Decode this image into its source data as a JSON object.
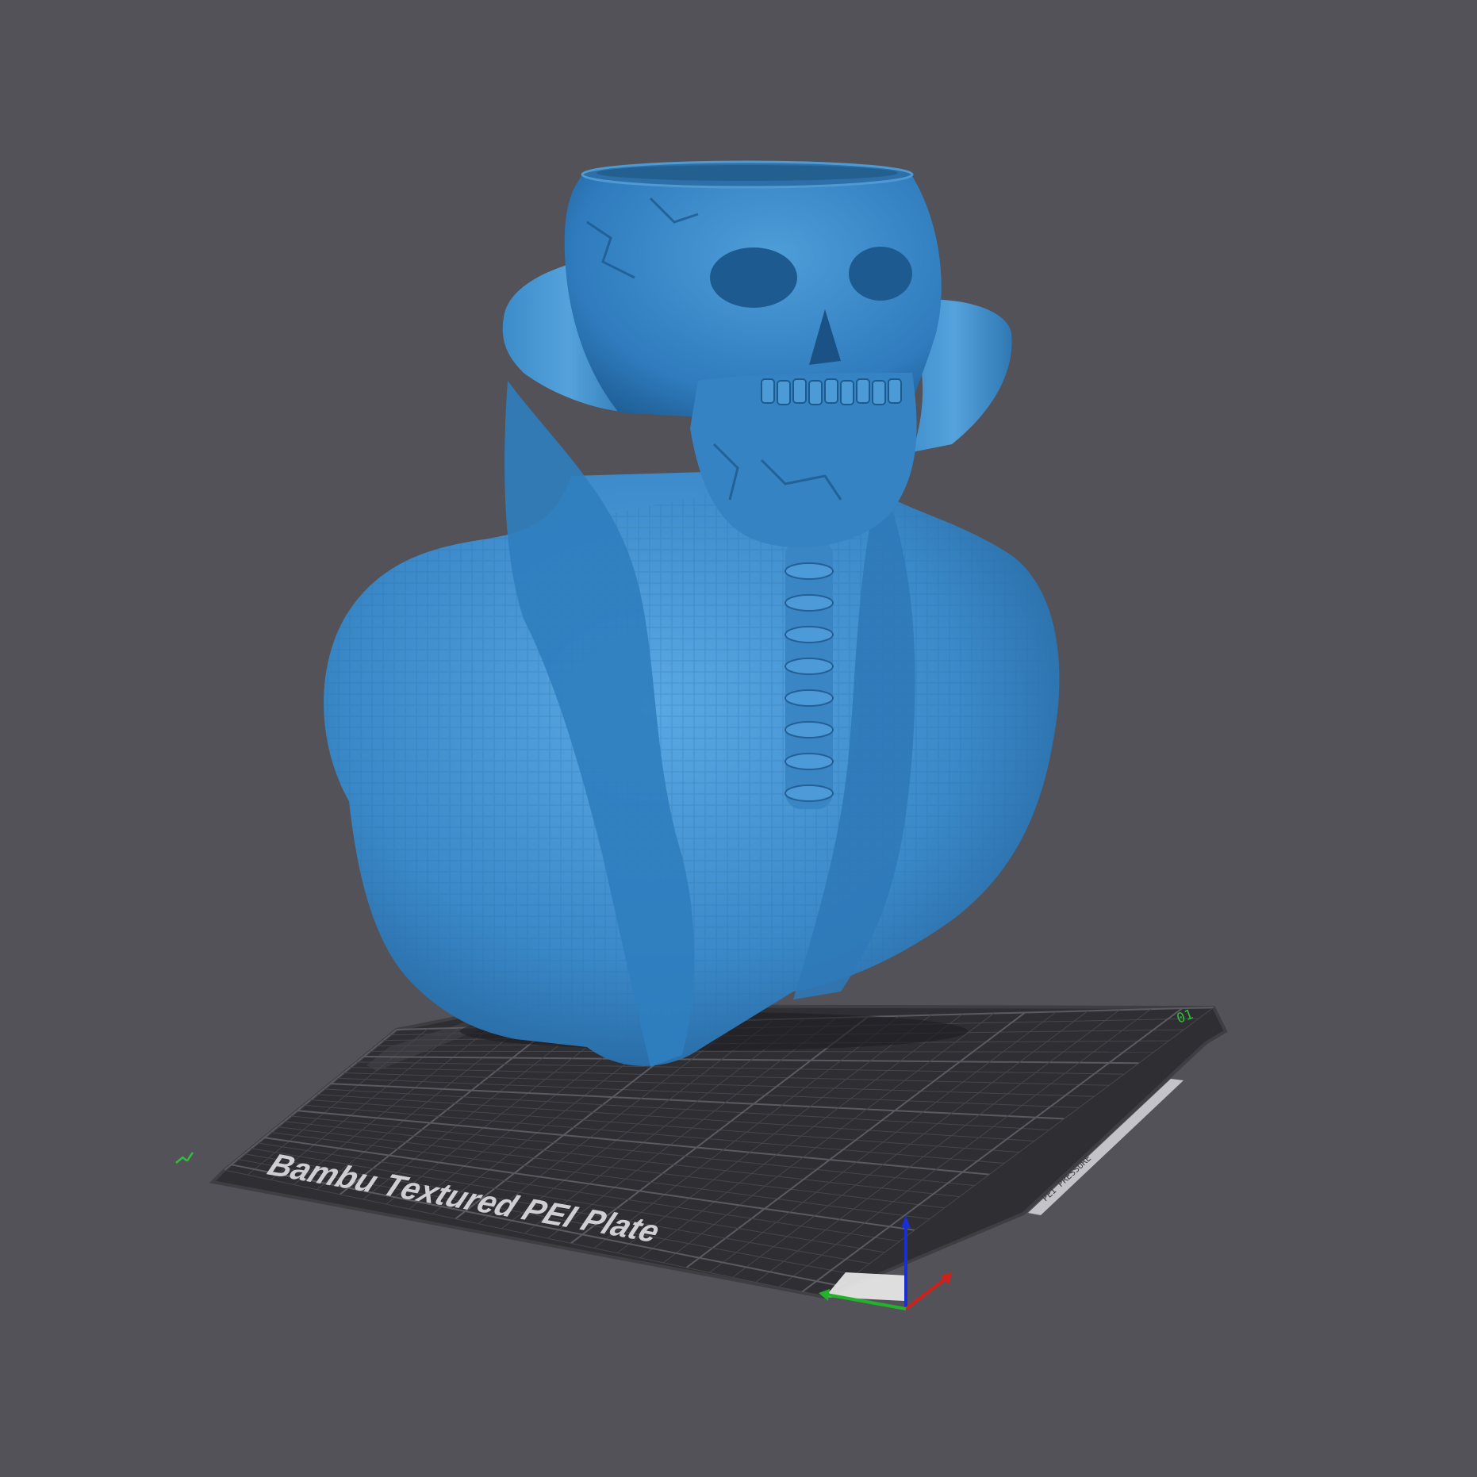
{
  "plate": {
    "label": "Bambu Textured PEI Plate",
    "plate_number": "01",
    "side_text": "PEI PRESSURE"
  },
  "colors": {
    "background": "#535258",
    "plate": "#2f2f33",
    "plate_border": "#3e3e43",
    "grid": "#45454b",
    "grid_major": "#5a5a60",
    "model": "#3b89c9",
    "model_shadow": "#1f5f96",
    "model_highlight": "#5aa8e3",
    "label_text": "#cfcfd3",
    "marker_green": "#2fbf3a",
    "axis_x": "#d0201c",
    "axis_y": "#22b32a",
    "axis_z": "#1a2fd3"
  },
  "icons": {
    "axis_gizmo": "xyz-axes-icon",
    "origin_mark": "origin-marker-icon",
    "plate_number_mark": "plate-number-icon"
  }
}
